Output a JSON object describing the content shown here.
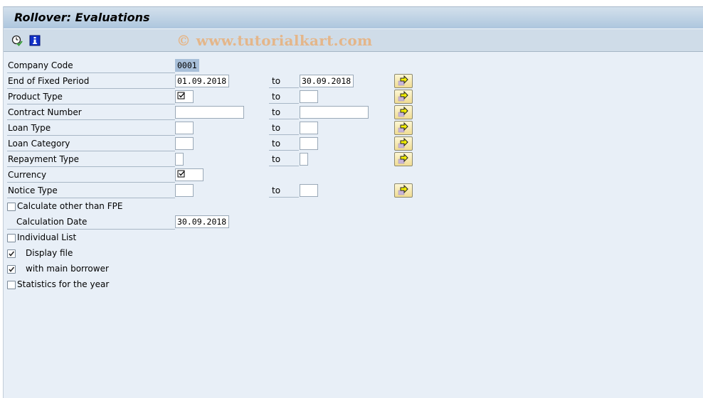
{
  "window": {
    "title": "Rollover: Evaluations"
  },
  "toolbar": {
    "items": [
      {
        "icon": "execute-clock-icon",
        "label": "Execute"
      },
      {
        "icon": "info-icon",
        "label": "Program Documentation"
      }
    ],
    "watermark": "© www.tutorialkart.com"
  },
  "form": {
    "company_code": {
      "label": "Company Code",
      "value": "0001"
    },
    "end_of_fixed_period": {
      "label": "End of Fixed Period",
      "from": "01.09.2018",
      "to_label": "to",
      "to": "30.09.2018"
    },
    "product_type": {
      "label": "Product Type",
      "from": "☑",
      "to_label": "to",
      "to": ""
    },
    "contract_number": {
      "label": "Contract Number",
      "from": "",
      "to_label": "to",
      "to": ""
    },
    "loan_type": {
      "label": "Loan Type",
      "from": "",
      "to_label": "to",
      "to": ""
    },
    "loan_category": {
      "label": "Loan Category",
      "from": "",
      "to_label": "to",
      "to": ""
    },
    "repayment_type": {
      "label": "Repayment Type",
      "from": "",
      "to_label": "to",
      "to": ""
    },
    "currency": {
      "label": "Currency",
      "value": "☑"
    },
    "notice_type": {
      "label": "Notice Type",
      "from": "",
      "to_label": "to",
      "to": ""
    },
    "calc_other_than_fpe": {
      "label": "Calculate other than FPE",
      "checked": false
    },
    "calculation_date": {
      "label": "Calculation Date",
      "value": "30.09.2018"
    },
    "individual_list": {
      "label": "Individual List",
      "checked": false
    },
    "display_file": {
      "label": "Display file",
      "checked": true
    },
    "with_main_borrower": {
      "label": "with main borrower",
      "checked": true
    },
    "statistics_for_year": {
      "label": "Statistics for the year",
      "checked": false
    }
  },
  "multiple_selection": {
    "tooltip": "Multiple selection"
  },
  "colors": {
    "background": "#e8eff7",
    "title_bar": "#adc6de",
    "toolbar": "#cfdce8",
    "selection": "#a8bfd9",
    "button": "#f0dc93"
  }
}
